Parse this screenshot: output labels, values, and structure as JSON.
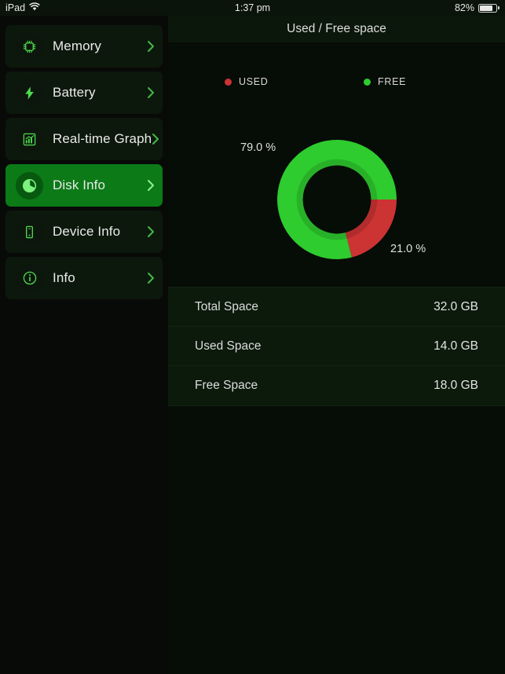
{
  "status_bar": {
    "device": "iPad",
    "wifi_icon": "wifi-icon",
    "time": "1:37 pm",
    "battery_percent": "82%",
    "battery_level": 82,
    "battery_icon": "battery-icon"
  },
  "sidebar": {
    "items": [
      {
        "label": "Memory",
        "icon": "chip-icon",
        "selected": false,
        "chevron": "chevron-right-icon"
      },
      {
        "label": "Battery",
        "icon": "bolt-icon",
        "selected": false,
        "chevron": "chevron-right-icon"
      },
      {
        "label": "Real-time Graph",
        "icon": "bar-chart-icon",
        "selected": false,
        "chevron": "chevron-right-icon"
      },
      {
        "label": "Disk Info",
        "icon": "pie-disk-icon",
        "selected": true,
        "chevron": "chevron-right-icon"
      },
      {
        "label": "Device Info",
        "icon": "device-icon",
        "selected": false,
        "chevron": "chevron-right-icon"
      },
      {
        "label": "Info",
        "icon": "info-icon",
        "selected": false,
        "chevron": "chevron-right-icon"
      }
    ]
  },
  "main": {
    "header_title": "Used / Free space",
    "legend": [
      {
        "label": "USED",
        "color": "#cc3333"
      },
      {
        "label": "FREE",
        "color": "#2ecc2e"
      }
    ],
    "labels": {
      "free_pct": "79.0 %",
      "used_pct": "21.0 %"
    },
    "table": {
      "rows": [
        {
          "key": "Total Space",
          "value": "32.0 GB"
        },
        {
          "key": "Used Space",
          "value": "14.0 GB"
        },
        {
          "key": "Free Space",
          "value": "18.0 GB"
        }
      ]
    }
  },
  "colors": {
    "accent_green": "#2ecc2e",
    "selected_row": "#0b7a17",
    "used_red": "#cc3333",
    "panel_bg": "#0b1a0b",
    "app_bg": "#060c06"
  },
  "chart_data": {
    "type": "pie",
    "title": "Used / Free space",
    "labels": [
      "FREE",
      "USED"
    ],
    "values": [
      79.0,
      21.0
    ],
    "value_labels": [
      "79.0 %",
      "21.0 %"
    ],
    "colors": [
      "#2ecc2e",
      "#cc3333"
    ],
    "units": "percent",
    "donut": true,
    "inner_radius_ratio": 0.57,
    "start_angle_deg": 90,
    "direction": "clockwise",
    "legend": [
      "USED",
      "FREE"
    ],
    "legend_position": "top",
    "grid": false,
    "related_totals": {
      "total_space_gb": 32.0,
      "used_space_gb": 14.0,
      "free_space_gb": 18.0
    }
  }
}
